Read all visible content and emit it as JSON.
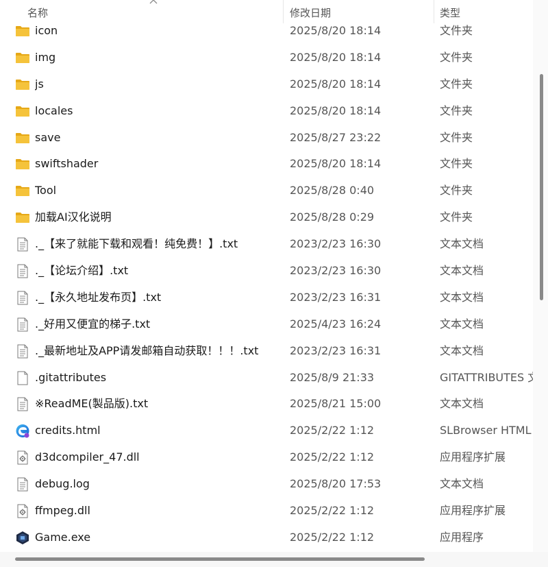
{
  "columns": {
    "name": "名称",
    "date": "修改日期",
    "type": "类型"
  },
  "colors": {
    "folder": "#f5c33b",
    "folder_dark": "#e6a817",
    "text": "#1a1a1a",
    "secondary_text": "#555555",
    "scrollbar": "#8a8a8a"
  },
  "files": [
    {
      "name": "icon",
      "date": "2025/8/20 18:14",
      "type": "文件夹",
      "icon": "folder-icon"
    },
    {
      "name": "img",
      "date": "2025/8/20 18:14",
      "type": "文件夹",
      "icon": "folder-icon"
    },
    {
      "name": "js",
      "date": "2025/8/20 18:14",
      "type": "文件夹",
      "icon": "folder-icon"
    },
    {
      "name": "locales",
      "date": "2025/8/20 18:14",
      "type": "文件夹",
      "icon": "folder-icon"
    },
    {
      "name": "save",
      "date": "2025/8/27 23:22",
      "type": "文件夹",
      "icon": "folder-icon"
    },
    {
      "name": "swiftshader",
      "date": "2025/8/20 18:14",
      "type": "文件夹",
      "icon": "folder-icon"
    },
    {
      "name": "Tool",
      "date": "2025/8/28 0:40",
      "type": "文件夹",
      "icon": "folder-icon"
    },
    {
      "name": "加载AI汉化说明",
      "date": "2025/8/28 0:29",
      "type": "文件夹",
      "icon": "folder-icon"
    },
    {
      "name": "._【来了就能下载和观看！纯免费！】.txt",
      "date": "2023/2/23 16:30",
      "type": "文本文档",
      "icon": "text-file-icon"
    },
    {
      "name": "._【论坛介绍】.txt",
      "date": "2023/2/23 16:30",
      "type": "文本文档",
      "icon": "text-file-icon"
    },
    {
      "name": "._【永久地址发布页】.txt",
      "date": "2023/2/23 16:31",
      "type": "文本文档",
      "icon": "text-file-icon"
    },
    {
      "name": "._好用又便宜的梯子.txt",
      "date": "2025/4/23 16:24",
      "type": "文本文档",
      "icon": "text-file-icon"
    },
    {
      "name": "._最新地址及APP请发邮箱自动获取！！！.txt",
      "date": "2023/2/23 16:31",
      "type": "文本文档",
      "icon": "text-file-icon"
    },
    {
      "name": ".gitattributes",
      "date": "2025/8/9 21:33",
      "type": "GITATTRIBUTES 文",
      "icon": "blank-file-icon"
    },
    {
      "name": "※ReadME(製品版).txt",
      "date": "2025/8/21 15:00",
      "type": "文本文档",
      "icon": "text-file-icon"
    },
    {
      "name": "credits.html",
      "date": "2025/2/22 1:12",
      "type": "SLBrowser HTML",
      "icon": "browser-icon"
    },
    {
      "name": "d3dcompiler_47.dll",
      "date": "2025/2/22 1:12",
      "type": "应用程序扩展",
      "icon": "dll-file-icon"
    },
    {
      "name": "debug.log",
      "date": "2025/8/20 17:53",
      "type": "文本文档",
      "icon": "text-file-icon"
    },
    {
      "name": "ffmpeg.dll",
      "date": "2025/2/22 1:12",
      "type": "应用程序扩展",
      "icon": "dll-file-icon"
    },
    {
      "name": "Game.exe",
      "date": "2025/2/22 1:12",
      "type": "应用程序",
      "icon": "exe-icon"
    }
  ]
}
